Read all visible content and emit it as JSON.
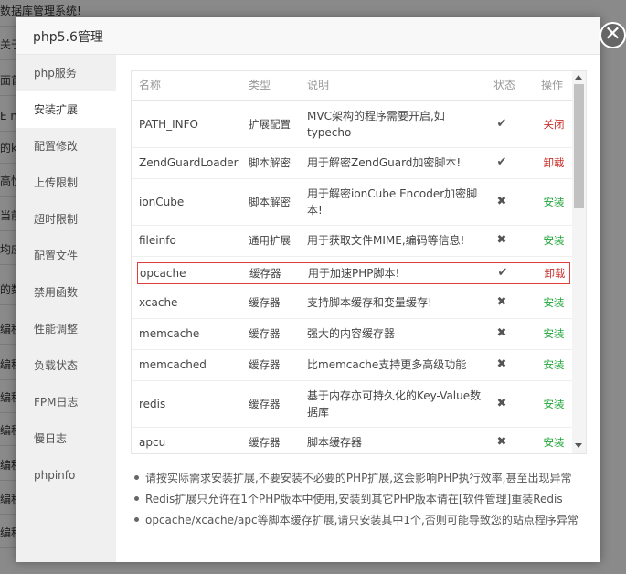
{
  "background": {
    "lines": [
      "数据库管理系统!",
      "关于",
      "面首",
      "E no",
      "的k",
      "高性",
      "当前",
      "均应",
      "的数",
      "编程",
      "编程",
      "编程",
      "编程",
      "编程",
      "编程",
      "编程"
    ]
  },
  "modal": {
    "title": "php5.6管理",
    "close_label": "✕"
  },
  "sidebar": {
    "items": [
      {
        "label": "php服务"
      },
      {
        "label": "安装扩展"
      },
      {
        "label": "配置修改"
      },
      {
        "label": "上传限制"
      },
      {
        "label": "超时限制"
      },
      {
        "label": "配置文件"
      },
      {
        "label": "禁用函数"
      },
      {
        "label": "性能调整"
      },
      {
        "label": "负载状态"
      },
      {
        "label": "FPM日志"
      },
      {
        "label": "慢日志"
      },
      {
        "label": "phpinfo"
      }
    ],
    "active_index": 1
  },
  "table": {
    "headers": {
      "name": "名称",
      "type": "类型",
      "desc": "说明",
      "status": "状态",
      "op": "操作"
    },
    "rows": [
      {
        "name": "PATH_INFO",
        "type": "扩展配置",
        "desc": "MVC架构的程序需要开启,如typecho",
        "installed": true,
        "op": "关闭"
      },
      {
        "name": "ZendGuardLoader",
        "type": "脚本解密",
        "desc": "用于解密ZendGuard加密脚本!",
        "installed": true,
        "op": "卸载"
      },
      {
        "name": "ionCube",
        "type": "脚本解密",
        "desc": "用于解密ionCube Encoder加密脚本!",
        "installed": false,
        "op": "安装"
      },
      {
        "name": "fileinfo",
        "type": "通用扩展",
        "desc": "用于获取文件MIME,编码等信息!",
        "installed": false,
        "op": "安装"
      },
      {
        "name": "opcache",
        "type": "缓存器",
        "desc": "用于加速PHP脚本!",
        "installed": true,
        "op": "卸载"
      },
      {
        "name": "xcache",
        "type": "缓存器",
        "desc": "支持脚本缓存和变量缓存!",
        "installed": false,
        "op": "安装"
      },
      {
        "name": "memcache",
        "type": "缓存器",
        "desc": "强大的内容缓存器",
        "installed": false,
        "op": "安装"
      },
      {
        "name": "memcached",
        "type": "缓存器",
        "desc": "比memcache支持更多高级功能",
        "installed": false,
        "op": "安装"
      },
      {
        "name": "redis",
        "type": "缓存器",
        "desc": "基于内存亦可持久化的Key-Value数据库",
        "installed": false,
        "op": "安装"
      },
      {
        "name": "apcu",
        "type": "缓存器",
        "desc": "脚本缓存器",
        "installed": false,
        "op": "安装"
      }
    ],
    "highlighted_row": 4
  },
  "icons": {
    "installed": "✔",
    "not_installed": "✖"
  },
  "notes": [
    "请按实际需求安装扩展,不要安装不必要的PHP扩展,这会影响PHP执行效率,甚至出现异常",
    "Redis扩展只允许在1个PHP版本中使用,安装到其它PHP版本请在[软件管理]重装Redis",
    "opcache/xcache/apc等脚本缓存扩展,请只安装其中1个,否则可能导致您的站点程序异常"
  ],
  "colors": {
    "op_remove": "#c9302c",
    "op_install": "#20a53a",
    "highlight_border": "#e63b3b"
  }
}
